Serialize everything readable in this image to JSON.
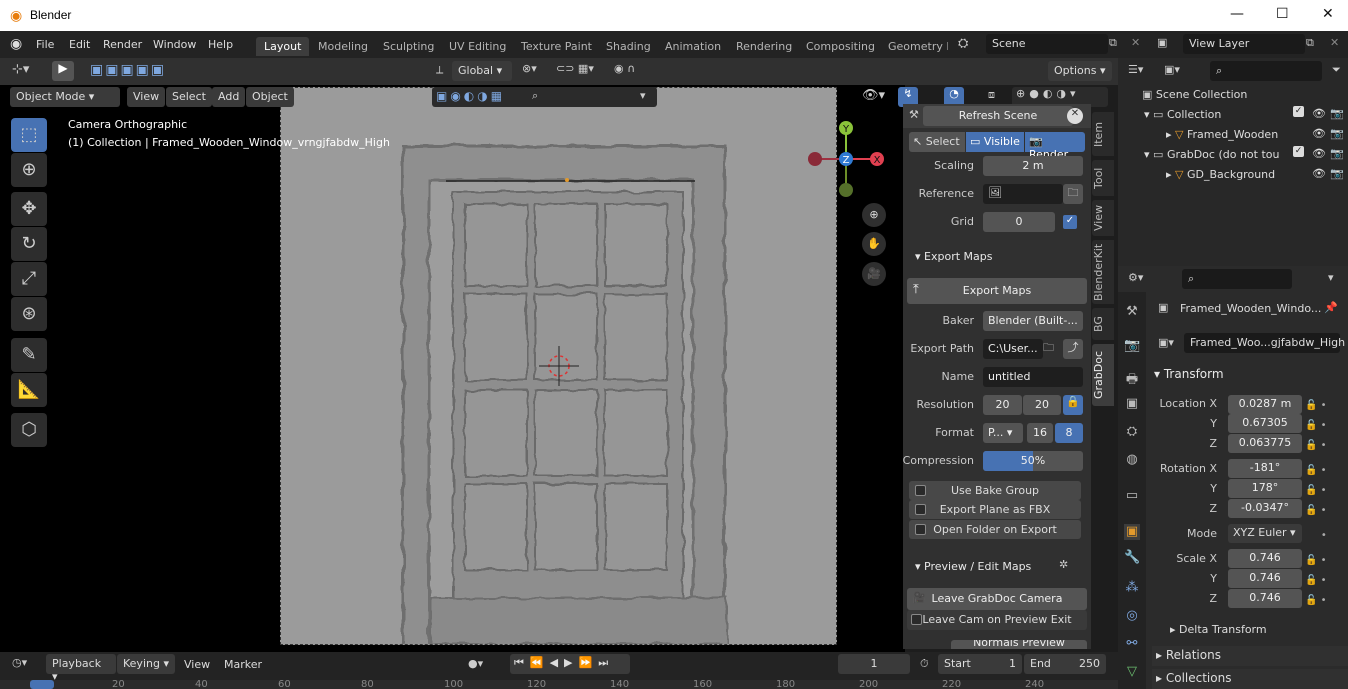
{
  "window": {
    "title": "Blender"
  },
  "menu": [
    "File",
    "Edit",
    "Render",
    "Window",
    "Help"
  ],
  "workspaces": [
    "Layout",
    "Modeling",
    "Sculpting",
    "UV Editing",
    "Texture Paint",
    "Shading",
    "Animation",
    "Rendering",
    "Compositing",
    "Geometry N"
  ],
  "scene": {
    "label": "Scene"
  },
  "view_layer": {
    "label": "View Layer"
  },
  "header": {
    "orientation": "Global",
    "options": "Options",
    "mode": "Object Mode",
    "view": "View",
    "select": "Select",
    "add": "Add",
    "object": "Object"
  },
  "viewport": {
    "camera_label": "Camera Orthographic",
    "collection_label": "(1) Collection | Framed_Wooden_Window_vrngjfabdw_High",
    "gizmo": {
      "x": "X",
      "y": "Y",
      "z": "Z"
    }
  },
  "npanel": {
    "refresh": "Refresh Scene",
    "select": "Select",
    "visible": "Visible",
    "render": "Render",
    "scaling_label": "Scaling",
    "scaling_value": "2 m",
    "reference_label": "Reference",
    "grid_label": "Grid",
    "grid_value": "0",
    "export_maps_section": "Export Maps",
    "export_maps_button": "Export Maps",
    "baker_label": "Baker",
    "baker_value": "Blender (Built-...",
    "export_path_label": "Export Path",
    "export_path_value": "C:\\User...",
    "name_label": "Name",
    "name_value": "untitled",
    "resolution_label": "Resolution",
    "res_x": "20",
    "res_y": "20",
    "format_label": "Format",
    "format_value": "P...",
    "bit16": "16",
    "bit8": "8",
    "compression_label": "Compression",
    "compression_value": "50%",
    "compression_fraction": 0.5,
    "use_bake_group": "Use Bake Group",
    "export_plane_fbx": "Export Plane as FBX",
    "open_folder": "Open Folder on Export",
    "preview_section": "Preview / Edit Maps",
    "leave_camera": "Leave GrabDoc Camera",
    "leave_cam_exit": "Leave Cam on Preview Exit",
    "next_cut": "Normals Preview"
  },
  "vtabs": [
    "Item",
    "Tool",
    "View",
    "BlenderKit",
    "BG",
    "GrabDoc"
  ],
  "outliner": {
    "scene_collection": "Scene Collection",
    "items": [
      "Collection",
      "Framed_Wooden",
      "GrabDoc (do not tou",
      "GD_Background"
    ]
  },
  "properties": {
    "object_name": "Framed_Wooden_Windo...",
    "mesh_name": "Framed_Woo...gjfabdw_High",
    "transform": "Transform",
    "location_x_label": "Location X",
    "location_x": "0.0287 m",
    "y_label": "Y",
    "z_label": "Z",
    "location_y": "0.67305",
    "location_z": "0.063775",
    "rotation_x_label": "Rotation X",
    "rotation_x": "-181°",
    "rotation_y": "178°",
    "rotation_z": "-0.0347°",
    "mode_label": "Mode",
    "mode_value": "XYZ Euler",
    "scale_x_label": "Scale X",
    "scale_x": "0.746",
    "scale_y": "0.746",
    "scale_z": "0.746",
    "delta_transform": "Delta Transform",
    "relations": "Relations",
    "collections": "Collections"
  },
  "timeline": {
    "playback": "Playback",
    "keying": "Keying",
    "view": "View",
    "marker": "Marker",
    "current_frame": "1",
    "start_label": "Start",
    "start": "1",
    "end_label": "End",
    "end": "250",
    "ruler": [
      "20",
      "40",
      "60",
      "80",
      "100",
      "120",
      "140",
      "160",
      "180",
      "200",
      "220",
      "240"
    ]
  }
}
